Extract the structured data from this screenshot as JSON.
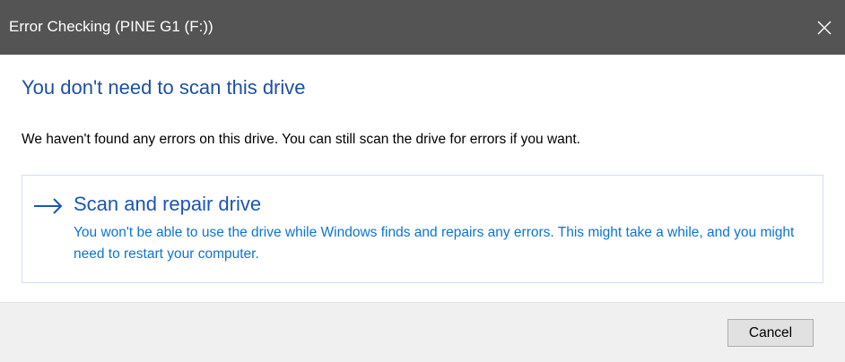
{
  "window": {
    "title": "Error Checking (PINE G1 (F:))"
  },
  "main": {
    "heading": "You don't need to scan this drive",
    "message": "We haven't found any errors on this drive. You can still scan the drive for errors if you want."
  },
  "command_link": {
    "icon": "arrow-right-icon",
    "title": "Scan and repair drive",
    "description": "You won't be able to use the drive while Windows finds and repairs any errors. This might take a while, and you might need to restart your computer."
  },
  "footer": {
    "cancel_label": "Cancel"
  },
  "colors": {
    "titlebar": "#545454",
    "heading": "#1e50a2",
    "link_title": "#1a56b4",
    "link_desc": "#0e74d2",
    "footer_bg": "#f0f0f0"
  }
}
